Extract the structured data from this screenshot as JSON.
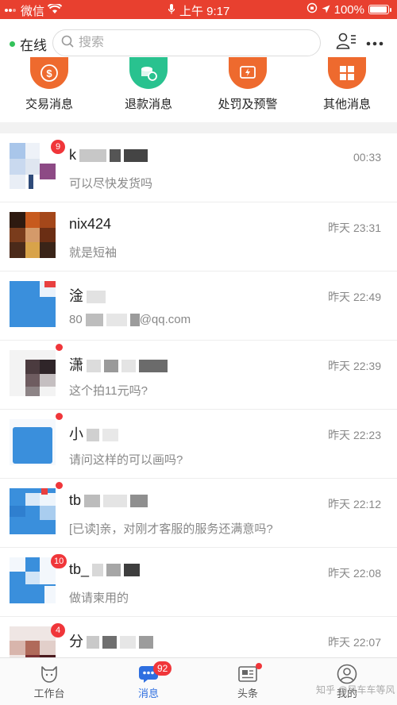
{
  "status_bar": {
    "carrier": "微信",
    "time": "上午 9:17",
    "battery": "100%",
    "battery_level": 1.0
  },
  "header": {
    "status_label": "在线",
    "search_placeholder": "搜索"
  },
  "categories": [
    {
      "label": "交易消息",
      "color": "#ee6a2e",
      "icon": "dollar-icon"
    },
    {
      "label": "退款消息",
      "color": "#29c28f",
      "icon": "refund-icon"
    },
    {
      "label": "处罚及预警",
      "color": "#ee6a2e",
      "icon": "warning-icon"
    },
    {
      "label": "其他消息",
      "color": "#ee6a2e",
      "icon": "grid-icon"
    }
  ],
  "conversations": [
    {
      "name": "k",
      "preview": "可以尽快发货吗",
      "time": "00:33",
      "badge": "9"
    },
    {
      "name": "nix424",
      "preview": "就是短袖",
      "time": "昨天 23:31",
      "badge": ""
    },
    {
      "name": "淦",
      "preview": "80",
      "preview_tail": "@qq.com",
      "time": "昨天 22:49",
      "badge": ""
    },
    {
      "name": "潇",
      "preview": "这个拍11元吗?",
      "time": "昨天 22:39",
      "badge": ""
    },
    {
      "name": "小",
      "preview": "请问这样的可以画吗?",
      "time": "昨天 22:23",
      "badge": ""
    },
    {
      "name": "tb",
      "preview": "[已读]亲，对刚才客服的服务还满意吗?",
      "time": "昨天 22:12",
      "badge": ""
    },
    {
      "name": "tb_",
      "preview": "做请柬用的",
      "time": "昨天 22:08",
      "badge": "10"
    },
    {
      "name": "分",
      "preview": "",
      "time": "昨天 22:07",
      "badge": "4"
    }
  ],
  "tabs": [
    {
      "label": "工作台",
      "icon": "cow-icon"
    },
    {
      "label": "消息",
      "icon": "chat-icon",
      "badge": "92"
    },
    {
      "label": "头条",
      "icon": "news-icon"
    },
    {
      "label": "我的",
      "icon": "profile-icon"
    }
  ],
  "watermark": "知乎 @风车车等风"
}
